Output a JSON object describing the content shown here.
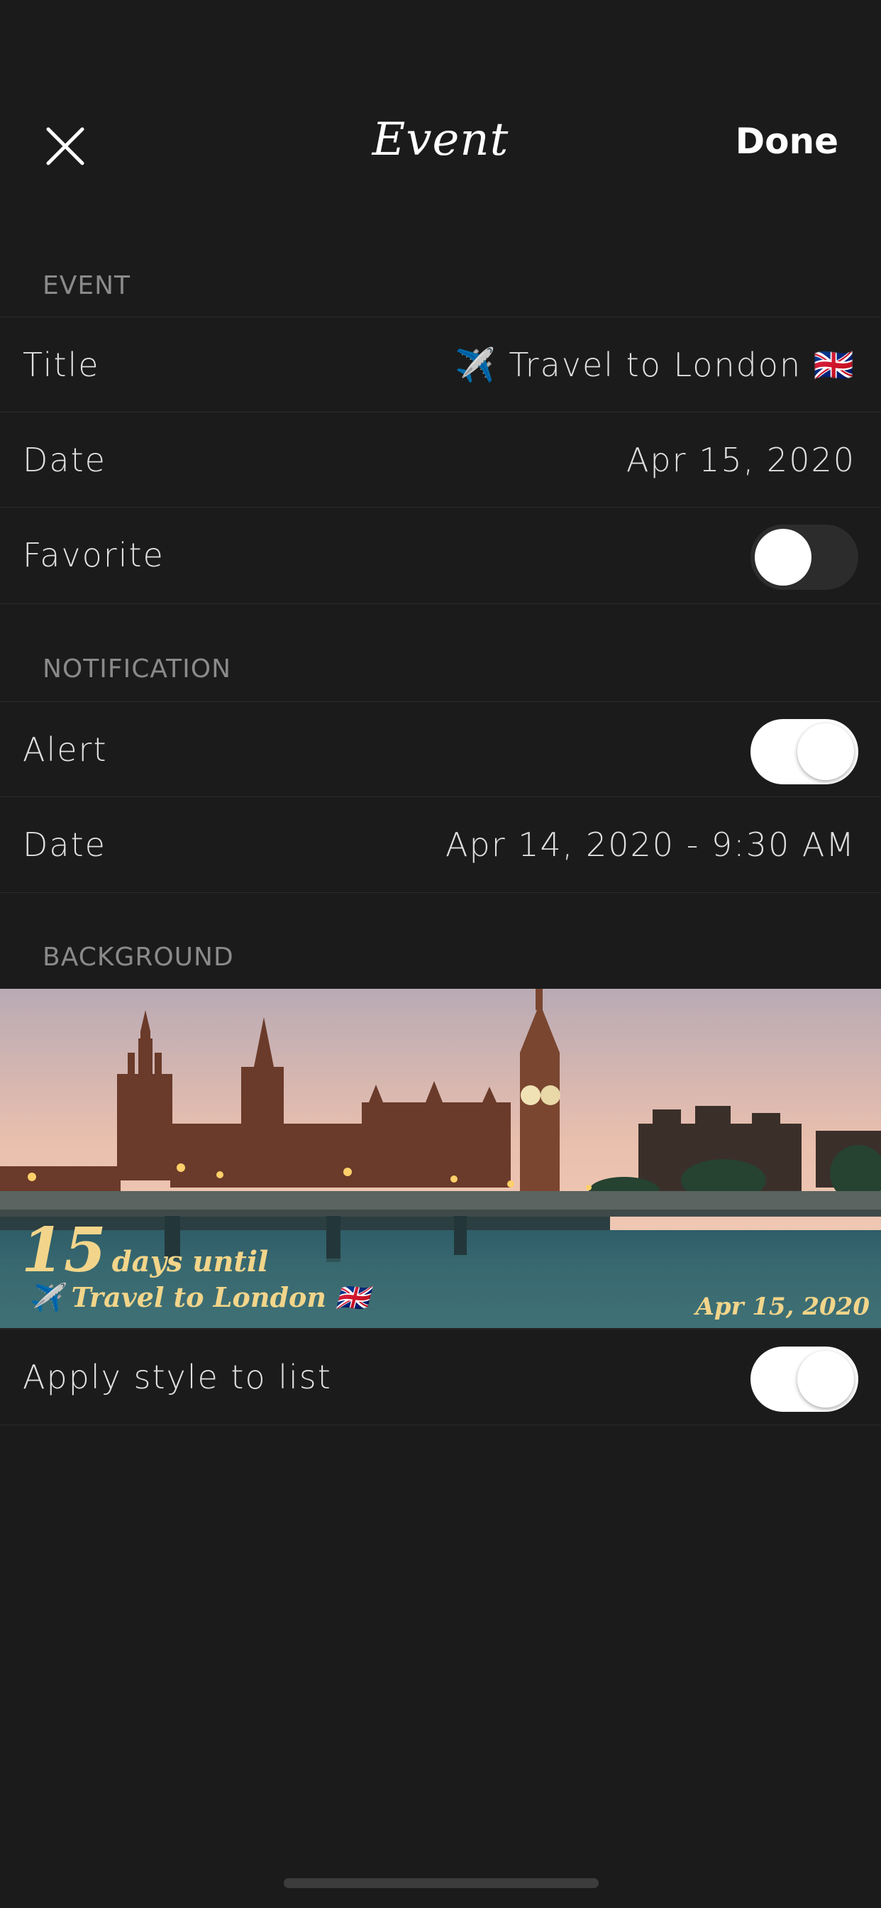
{
  "nav": {
    "title": "Event",
    "done_label": "Done"
  },
  "sections": {
    "event_header": "EVENT",
    "notification_header": "NOTIFICATION",
    "background_header": "BACKGROUND"
  },
  "event": {
    "title_label": "Title",
    "title_value": "✈️ Travel to London 🇬🇧",
    "date_label": "Date",
    "date_value": "Apr 15, 2020",
    "favorite_label": "Favorite",
    "favorite_on": false
  },
  "notification": {
    "alert_label": "Alert",
    "alert_on": true,
    "date_label": "Date",
    "date_value": "Apr 14, 2020 - 9:30 AM"
  },
  "background": {
    "count_number": "15",
    "count_suffix": "days until",
    "event_title": "✈️ Travel to London 🇬🇧",
    "event_date": "Apr 15, 2020"
  },
  "apply_style": {
    "label": "Apply style to list",
    "on": true
  },
  "colors": {
    "background": "#1b1b1b",
    "overlay_text": "#f2d58a",
    "section_header": "#8a8a8a"
  },
  "icons": {
    "close": "close-icon"
  }
}
